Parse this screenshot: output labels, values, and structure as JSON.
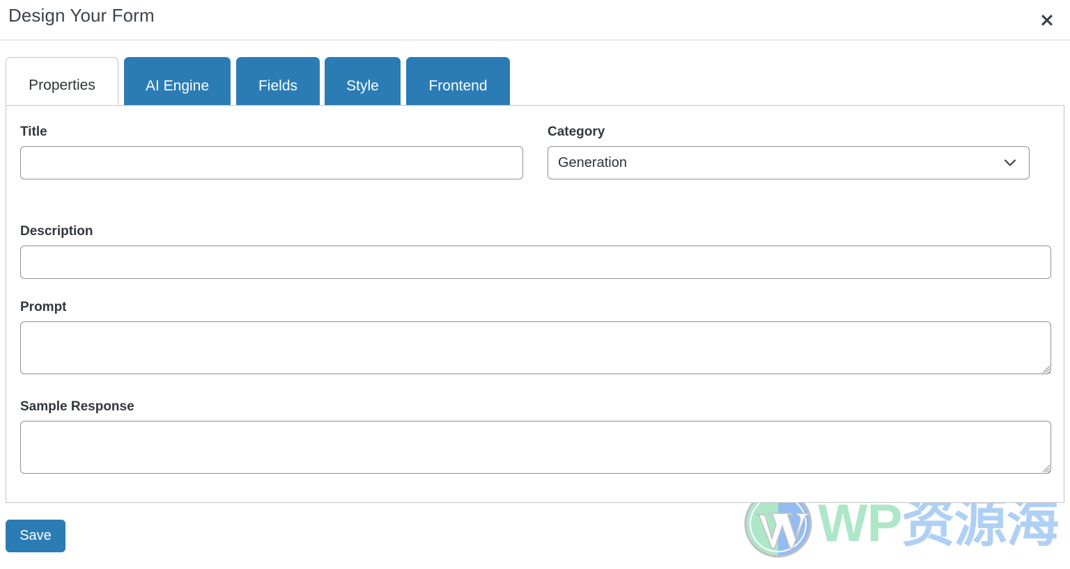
{
  "header": {
    "title": "Design Your Form",
    "close_icon": "close-x-icon"
  },
  "tabs": [
    {
      "label": "Properties",
      "active": true
    },
    {
      "label": "AI Engine",
      "active": false
    },
    {
      "label": "Fields",
      "active": false
    },
    {
      "label": "Style",
      "active": false
    },
    {
      "label": "Frontend",
      "active": false
    }
  ],
  "form": {
    "title": {
      "label": "Title",
      "value": "",
      "placeholder": ""
    },
    "category": {
      "label": "Category",
      "value": "Generation",
      "chevron_icon": "chevron-down-icon",
      "options": [
        "Generation"
      ]
    },
    "description": {
      "label": "Description",
      "value": "",
      "placeholder": ""
    },
    "prompt": {
      "label": "Prompt",
      "value": "",
      "placeholder": ""
    },
    "sample_response": {
      "label": "Sample Response",
      "value": "",
      "placeholder": ""
    }
  },
  "footer": {
    "save_label": "Save"
  },
  "watermark": {
    "logo_icon": "wordpress-logo-icon",
    "text_en": "WP",
    "text_cn": "资源海"
  },
  "colors": {
    "tab_active_bg": "#ffffff",
    "tab_inactive_bg": "#2b7cb5",
    "accent": "#2b7cb5",
    "panel_border": "#c3c4c7",
    "input_border": "#8c8f94",
    "label_text": "#32373c",
    "title_text": "#3c434a",
    "watermark_en": "#a8e6c4",
    "watermark_cn": "#a9cdf5"
  }
}
